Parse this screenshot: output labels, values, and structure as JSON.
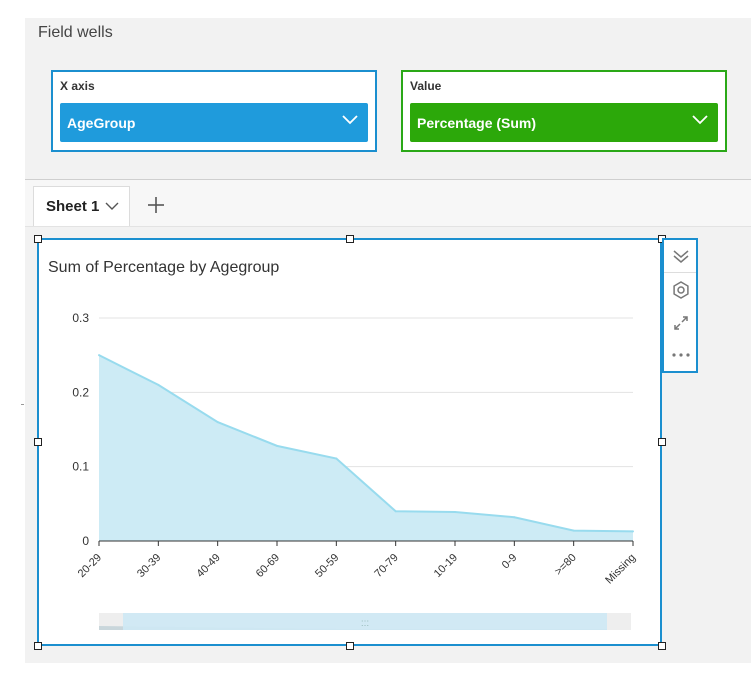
{
  "field_wells": {
    "title": "Field wells",
    "x_axis": {
      "label": "X axis",
      "field": "AgeGroup"
    },
    "value": {
      "label": "Value",
      "field": "Percentage (Sum)"
    }
  },
  "sheets": {
    "tabs": [
      {
        "label": "Sheet 1"
      }
    ],
    "add_icon": "plus-icon"
  },
  "visual": {
    "toolbar_icons": [
      "collapse-chevrons-icon",
      "settings-gear-icon",
      "expand-icon",
      "more-dots-icon"
    ],
    "scroll_grip": ":::"
  },
  "colors": {
    "area_fill": "#cdebf5",
    "area_line": "#98dbee",
    "selection_border": "#1b8fcf",
    "x_well_fill": "#1f9bdc",
    "value_well_fill": "#2ca80a"
  },
  "chart_data": {
    "type": "area",
    "title": "Sum of Percentage by Agegroup",
    "xlabel": "",
    "ylabel": "",
    "categories": [
      "20-29",
      "30-39",
      "40-49",
      "60-69",
      "50-59",
      "70-79",
      "10-19",
      "0-9",
      ">=80",
      "Missing"
    ],
    "values": [
      0.25,
      0.21,
      0.16,
      0.128,
      0.111,
      0.04,
      0.039,
      0.032,
      0.014,
      0.013
    ],
    "ylim": [
      0,
      0.3
    ],
    "yticks": [
      "0",
      "0.1",
      "0.2",
      "0.3"
    ],
    "grid": true
  }
}
